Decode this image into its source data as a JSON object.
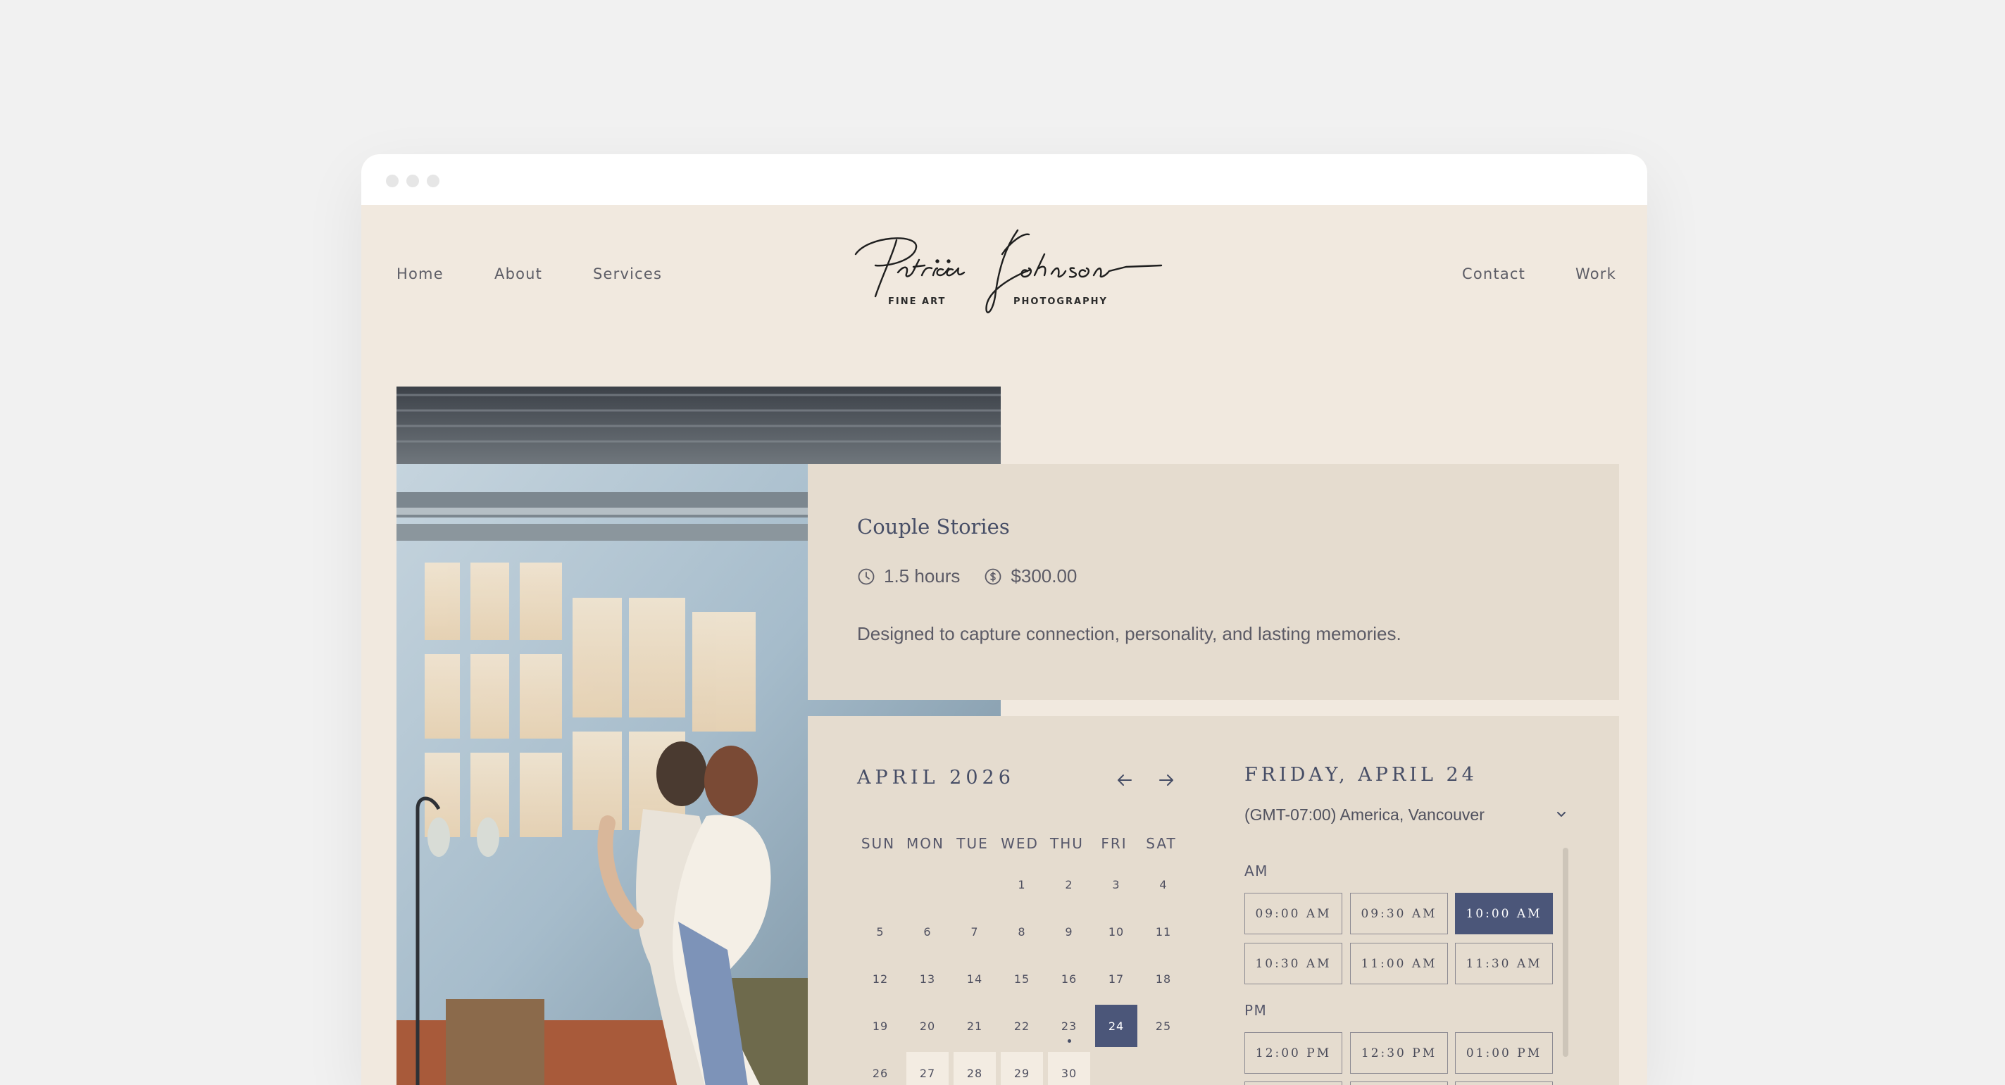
{
  "nav": {
    "home": "Home",
    "about": "About",
    "services": "Services",
    "contact": "Contact",
    "work": "Work"
  },
  "logo": {
    "script": "Patricia Johnson",
    "sub_left": "FINE ART",
    "sub_right": "PHOTOGRAPHY"
  },
  "service": {
    "title": "Couple Stories",
    "duration": "1.5 hours",
    "price": "$300.00",
    "description": "Designed to capture connection, personality, and lasting memories."
  },
  "calendar": {
    "month_label": "APRIL 2026",
    "weekdays": [
      "SUN",
      "MON",
      "TUE",
      "WED",
      "THU",
      "FRI",
      "SAT"
    ],
    "days": [
      "1",
      "2",
      "3",
      "4",
      "5",
      "6",
      "7",
      "8",
      "9",
      "10",
      "11",
      "12",
      "13",
      "14",
      "15",
      "16",
      "17",
      "18",
      "19",
      "20",
      "21",
      "22",
      "23",
      "24",
      "25",
      "26",
      "27",
      "28",
      "29",
      "30"
    ],
    "selected_day": "24",
    "today_dot_day": "23",
    "available_days": [
      "27",
      "28",
      "29",
      "30"
    ]
  },
  "schedule": {
    "selected_date": "FRIDAY, APRIL 24",
    "timezone": "(GMT-07:00) America, Vancouver",
    "am_label": "AM",
    "pm_label": "PM",
    "am_slots": [
      "09:00 AM",
      "09:30 AM",
      "10:00 AM",
      "10:30 AM",
      "11:00 AM",
      "11:30 AM"
    ],
    "pm_slots": [
      "12:00 PM",
      "12:30 PM",
      "01:00 PM"
    ],
    "selected_slot": "10:00 AM"
  },
  "colors": {
    "page_background": "#f1e9df",
    "card_background": "#e5dccf",
    "accent": "#4b5679",
    "text": "#474e66"
  }
}
